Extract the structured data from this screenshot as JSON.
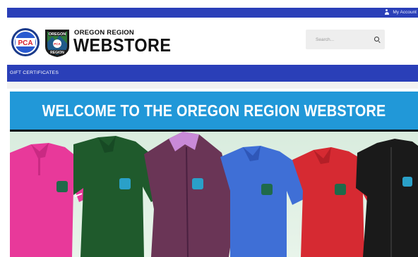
{
  "topbar": {
    "account_label": "My Account",
    "user_icon": "user-icon"
  },
  "header": {
    "brand_line1": "OREGON REGION",
    "brand_line2": "WEBSTORE",
    "logos": {
      "pca_text": "PCA",
      "region_text_top": "OREGON",
      "region_text_bottom": "REGION",
      "region_badge": "PCA"
    }
  },
  "search": {
    "placeholder": "Search...",
    "icon": "search-icon"
  },
  "nav": {
    "items": [
      {
        "label": "GIFT CERTIFICATES"
      }
    ]
  },
  "banner": {
    "headline": "WELCOME TO THE OREGON REGION WEBSTORE",
    "products": [
      {
        "type": "polo shirt",
        "color": "#e8399a"
      },
      {
        "type": "polo shirt",
        "color": "#1f5a2c"
      },
      {
        "type": "jacket",
        "color": "#6a3556"
      },
      {
        "type": "polo shirt",
        "color": "#3f6fd6"
      },
      {
        "type": "polo shirt",
        "color": "#d62a32"
      },
      {
        "type": "jacket",
        "color": "#1a1a1a"
      }
    ]
  },
  "colors": {
    "brand_blue": "#2a3fb8",
    "banner_blue": "#2198d8"
  }
}
